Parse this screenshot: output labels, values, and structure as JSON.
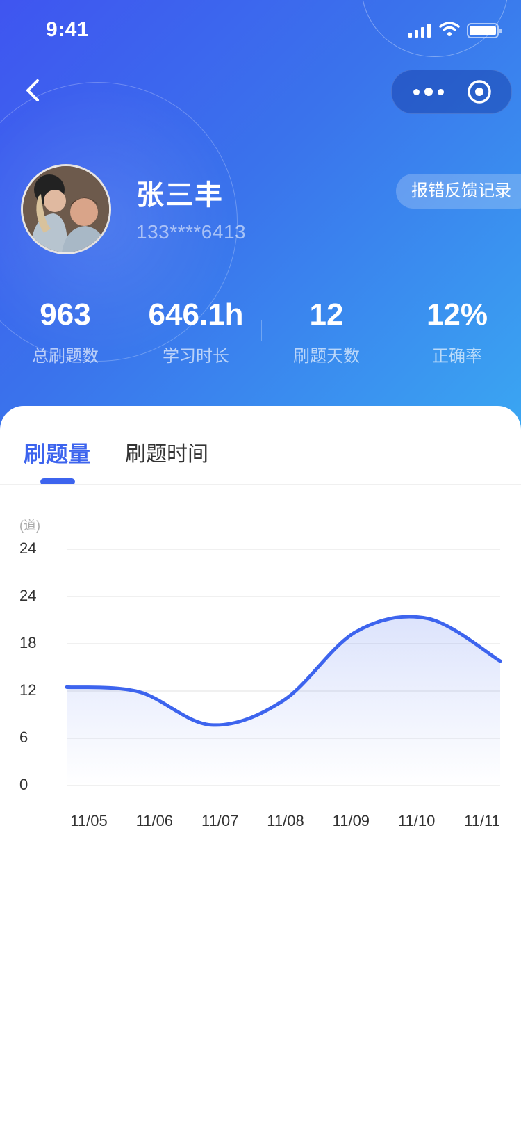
{
  "status_bar": {
    "time": "9:41"
  },
  "header": {
    "user": {
      "name": "张三丰",
      "phone": "133****6413"
    },
    "feedback_button": "报错反馈记录",
    "stats": [
      {
        "value": "963",
        "label": "总刷题数"
      },
      {
        "value": "646.1h",
        "label": "学习时长"
      },
      {
        "value": "12",
        "label": "刷题天数"
      },
      {
        "value": "12%",
        "label": "正确率"
      }
    ]
  },
  "tabs": [
    {
      "label": "刷题量",
      "active": true
    },
    {
      "label": "刷题时间",
      "active": false
    }
  ],
  "colors": {
    "accent": "#3d64ee",
    "header_start": "#3f55f0",
    "header_end": "#3aa6f2"
  },
  "chart_data": {
    "type": "area",
    "y_unit_label": "(道)",
    "y_tick_labels": [
      "24",
      "24",
      "18",
      "12",
      "6",
      "0"
    ],
    "ylim": [
      0,
      30
    ],
    "x": [
      "11/05",
      "11/06",
      "11/07",
      "11/08",
      "11/09",
      "11/10",
      "11/11"
    ],
    "series": [
      {
        "values": [
          12.5,
          11.9,
          7.7,
          10.8,
          19.5,
          21.2,
          15.8
        ]
      }
    ],
    "grid": true
  }
}
